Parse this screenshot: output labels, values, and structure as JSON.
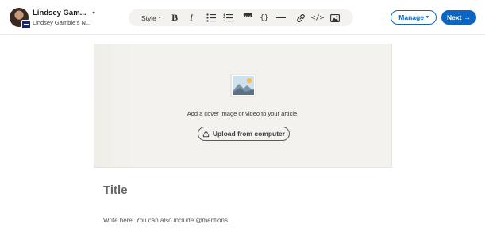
{
  "header": {
    "author_name": "Lindsey Gam...",
    "author_page": "Lindsey Gamble's N...",
    "style_label": "Style",
    "manage_label": "Manage",
    "next_label": "Next",
    "icons": {
      "author_caret": "chevron-down-icon",
      "bold": "bold-icon",
      "italic": "italic-icon",
      "bullet_list": "bulleted-list-icon",
      "numbered_list": "numbered-list-icon",
      "quote": "quote-icon",
      "code": "code-block-icon",
      "divider": "divider-icon",
      "link": "link-icon",
      "embed": "embed-code-icon",
      "image": "image-icon",
      "next_arrow": "arrow-right-icon"
    }
  },
  "toolbar_glyphs": {
    "bold": "B",
    "italic": "I",
    "quote": "❞❞",
    "code": "{}",
    "embed": "</>",
    "caret": "▾",
    "arrow": "→"
  },
  "cover": {
    "prompt": "Add a cover image or video to your article.",
    "upload_label": "Upload from computer",
    "illustration": "landscape-image-icon"
  },
  "editor": {
    "title_placeholder": "Title",
    "body_placeholder": "Write here. You can also include @mentions."
  },
  "colors": {
    "accent": "#0a66c2",
    "cover_bg": "#f3f2ee",
    "toolbar_bg": "#f3f2ef"
  }
}
